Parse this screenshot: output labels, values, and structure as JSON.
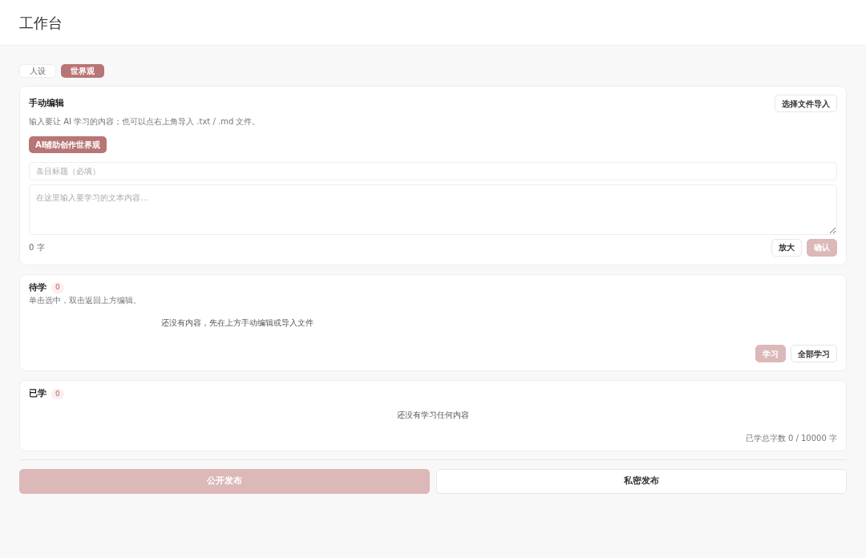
{
  "header": {
    "title": "工作台"
  },
  "tabs": [
    {
      "label": "人设",
      "selected": false
    },
    {
      "label": "世界观",
      "selected": true
    }
  ],
  "editor": {
    "title": "手动编辑",
    "hint": "输入要让 AI 学习的内容；也可以点右上角导入 .txt / .md 文件。",
    "import_button": "选择文件导入",
    "ai_button": "AI辅助创作世界观",
    "title_field": {
      "placeholder": "条目标题（必填）"
    },
    "content_field": {
      "placeholder": "在这里输入要学习的文本内容…"
    },
    "char_count": "0 字",
    "buttons": [
      {
        "label": "放大",
        "disabled": false
      },
      {
        "label": "确认",
        "disabled": true
      }
    ]
  },
  "pending": {
    "title": "待学",
    "count": "0",
    "hint": "单击选中，双击返回上方编辑。",
    "empty": "还没有内容，先在上方手动编辑或导入文件",
    "buttons": [
      {
        "label": "学习",
        "disabled": true
      },
      {
        "label": "全部学习",
        "disabled": false
      }
    ]
  },
  "learned": {
    "title": "已学",
    "count": "0",
    "empty": "还没有学习任何内容",
    "total": "已学总字数 0 / 10000 字"
  },
  "publish": [
    {
      "label": "公开发布",
      "disabled": true
    },
    {
      "label": "私密发布",
      "disabled": false
    }
  ]
}
